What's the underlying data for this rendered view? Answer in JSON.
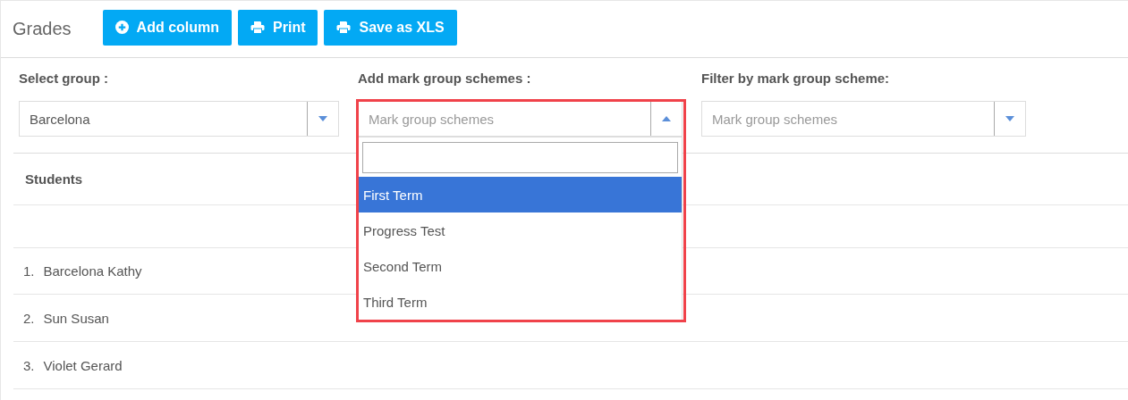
{
  "header": {
    "title": "Grades",
    "buttons": [
      {
        "label": "Add column",
        "kind": "add"
      },
      {
        "label": "Print",
        "kind": "print"
      },
      {
        "label": "Save as XLS",
        "kind": "print"
      }
    ]
  },
  "filters": [
    {
      "label": "Select group :",
      "value": "Barcelona",
      "open": false,
      "highlighted": false
    },
    {
      "label": "Add mark group schemes :",
      "placeholder": "Mark group schemes",
      "open": true,
      "highlighted": true,
      "options": [
        {
          "label": "First Term",
          "selected": true
        },
        {
          "label": "Progress Test",
          "selected": false
        },
        {
          "label": "Second Term",
          "selected": false
        },
        {
          "label": "Third Term",
          "selected": false
        }
      ]
    },
    {
      "label": "Filter by mark group scheme:",
      "placeholder": "Mark group schemes",
      "open": false,
      "highlighted": false
    }
  ],
  "table": {
    "column": "Students",
    "rows": [
      {
        "number": "1.",
        "name": "Barcelona Kathy"
      },
      {
        "number": "2.",
        "name": "Sun Susan"
      },
      {
        "number": "3.",
        "name": "Violet Gerard"
      }
    ]
  }
}
